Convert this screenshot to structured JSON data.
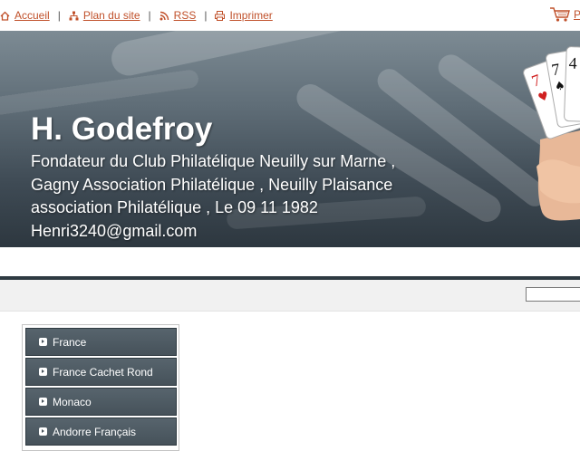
{
  "topbar": {
    "links": [
      {
        "label": "Accueil",
        "icon": "home-icon"
      },
      {
        "label": "Plan du site",
        "icon": "sitemap-icon"
      },
      {
        "label": "RSS",
        "icon": "rss-icon"
      },
      {
        "label": "Imprimer",
        "icon": "print-icon"
      }
    ],
    "separator": "|",
    "cart_label": "P",
    "cart_icon": "cart-icon"
  },
  "banner": {
    "title": "H. Godefroy",
    "subtitle": "Fondateur du Club Philatélique Neuilly sur Marne , Gagny Association Philatélique , Neuilly Plaisance association Philatélique , Le 09 11 1982 Henri3240@gmail.com",
    "image": "playing-cards-in-hand"
  },
  "search": {
    "value": "",
    "placeholder": ""
  },
  "menu": {
    "items": [
      {
        "label": "France"
      },
      {
        "label": "France Cachet Rond"
      },
      {
        "label": "Monaco"
      },
      {
        "label": "Andorre Français"
      }
    ]
  },
  "colors": {
    "link": "#c0502a",
    "banner_dark": "#2d373f",
    "menu_bg": "#4f5b63",
    "strip_bg": "#f1f1f1"
  }
}
